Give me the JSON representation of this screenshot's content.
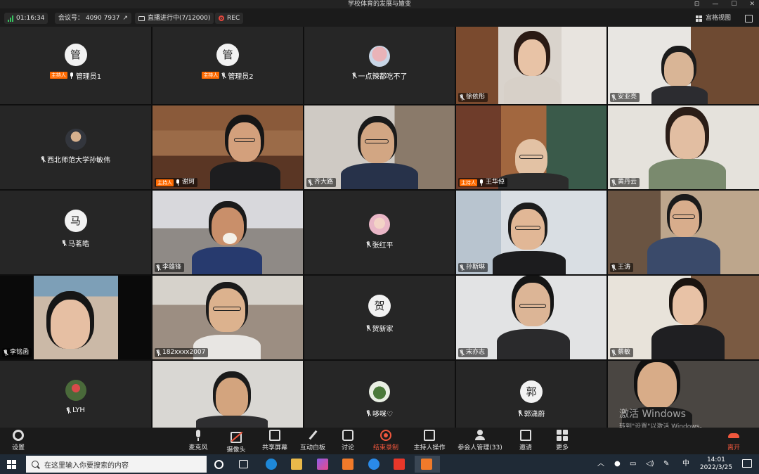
{
  "window": {
    "title": "学校体育的发展与嬗变"
  },
  "infobar": {
    "duration": "01:16:34",
    "meeting_id": "会议号： 4090 7937",
    "live": "直播进行中(7/12000)",
    "rec": "REC",
    "gallery": "宫格视图"
  },
  "host_tag": "主持人",
  "tiles": [
    {
      "name": "管理员1",
      "avatar": "管",
      "host": true,
      "mic": "on"
    },
    {
      "name": "管理员2",
      "avatar": "管",
      "host": true,
      "mic": "muted"
    },
    {
      "name": "一点辣都吃不了",
      "mic": "muted"
    },
    {
      "name": "徐依彤",
      "mic": "muted"
    },
    {
      "name": "安亚亮",
      "mic": "muted"
    },
    {
      "name": "西北师范大学孙敏伟",
      "mic": "muted"
    },
    {
      "name": "谢珂",
      "host": true,
      "mic": "on"
    },
    {
      "name": "齐大路",
      "mic": "muted"
    },
    {
      "name": "王华倬",
      "host": true,
      "mic": "on"
    },
    {
      "name": "黄丹云",
      "mic": "muted"
    },
    {
      "name": "马茗皓",
      "avatar": "马",
      "mic": "muted"
    },
    {
      "name": "李雄锋",
      "mic": "muted"
    },
    {
      "name": "张红平",
      "mic": "muted"
    },
    {
      "name": "孙斯琳",
      "mic": "muted"
    },
    {
      "name": "王涛",
      "mic": "muted"
    },
    {
      "name": "李铭函",
      "mic": "muted"
    },
    {
      "name": "182xxxx2007",
      "mic": "muted"
    },
    {
      "name": "贺新家",
      "avatar": "贺",
      "mic": "muted"
    },
    {
      "name": "宋亦志",
      "mic": "muted"
    },
    {
      "name": "蔡敏",
      "mic": "muted"
    },
    {
      "name": "LYH",
      "mic": "muted"
    },
    {
      "name": "",
      "mic": "none"
    },
    {
      "name": "哆咪♡",
      "mic": "muted"
    },
    {
      "name": "郭潇蔚",
      "avatar": "郭",
      "mic": "muted"
    },
    {
      "name": "",
      "mic": "none"
    }
  ],
  "watermark": {
    "line1": "激活 Windows",
    "line2": "转到\"设置\"以激活 Windows。"
  },
  "controls": {
    "settings": "设置",
    "mic": "麦克风",
    "camera": "摄像头",
    "share": "共享屏幕",
    "whiteboard": "互动白板",
    "chat": "讨论",
    "record": "结束录制",
    "host_ops": "主持人操作",
    "participants": "参会人管理(33)",
    "invite": "邀请",
    "more": "更多",
    "leave": "离开"
  },
  "taskbar": {
    "search_placeholder": "在这里输入你要搜索的内容",
    "ime": "中",
    "time": "14:01",
    "date": "2022/3/25"
  },
  "colors": {
    "accent_green": "#2ecc71",
    "host_orange": "#ff6a00",
    "record_red": "#f0573d"
  }
}
